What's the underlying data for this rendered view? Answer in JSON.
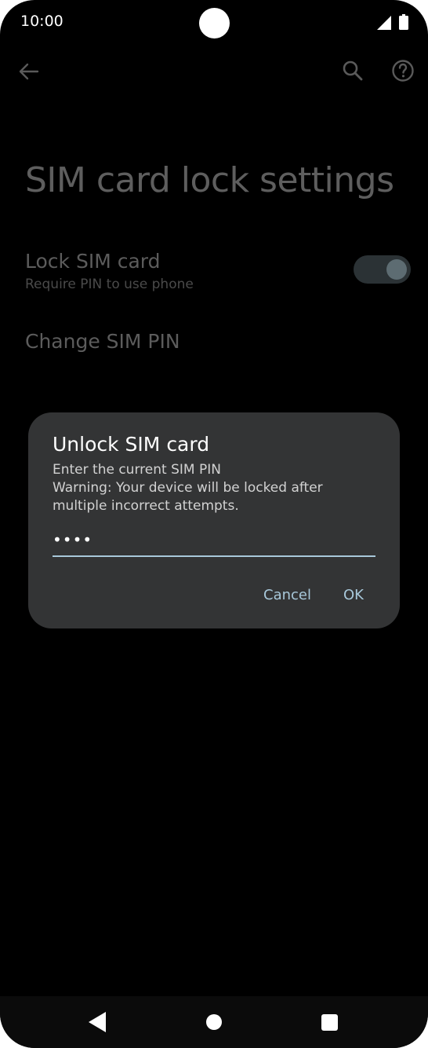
{
  "status_bar": {
    "time": "10:00",
    "icons": [
      "signal-icon",
      "battery-icon"
    ]
  },
  "toolbar": {
    "icons": [
      "back-arrow-icon",
      "search-icon",
      "help-icon"
    ]
  },
  "page": {
    "title": "SIM card lock settings"
  },
  "preferences": {
    "lock_sim": {
      "title": "Lock SIM card",
      "summary": "Require PIN to use phone",
      "enabled": true
    },
    "change_pin": {
      "title": "Change SIM PIN"
    }
  },
  "dialog": {
    "title": "Unlock SIM card",
    "message_lines": [
      "Enter the current SIM PIN",
      "Warning: Your device will be locked after",
      "multiple incorrect attempts."
    ],
    "pin_value": "••••",
    "cancel_label": "Cancel",
    "ok_label": "OK"
  },
  "navigation_bar": {
    "icons": [
      "nav-back-icon",
      "nav-home-icon",
      "nav-recents-icon"
    ]
  },
  "colors": {
    "background": "#000000",
    "dialog": "#333435",
    "accent": "#a8c8da",
    "dim_text": "#5e5e5e"
  }
}
